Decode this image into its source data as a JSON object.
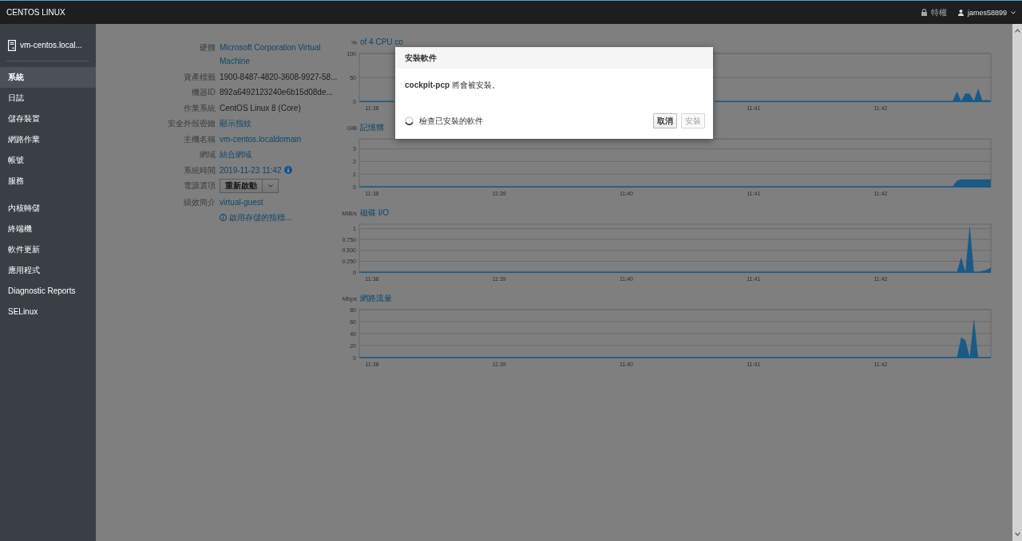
{
  "topbar": {
    "brand": "CENTOS LINUX",
    "privilege": "特權",
    "user": "james58899"
  },
  "sidebar": {
    "host": "vm-centos.local...",
    "groups": [
      {
        "items": [
          {
            "label": "系統",
            "selected": true
          },
          {
            "label": "日誌",
            "selected": false
          },
          {
            "label": "儲存裝置",
            "selected": false
          },
          {
            "label": "網路作業",
            "selected": false
          },
          {
            "label": "帳號",
            "selected": false
          },
          {
            "label": "服務",
            "selected": false
          }
        ]
      },
      {
        "items": [
          {
            "label": "內核轉儲",
            "selected": false
          },
          {
            "label": "終端機",
            "selected": false
          },
          {
            "label": "軟件更新",
            "selected": false
          },
          {
            "label": "應用程式",
            "selected": false
          },
          {
            "label": "Diagnostic Reports",
            "selected": false
          },
          {
            "label": "SELinux",
            "selected": false
          }
        ]
      }
    ]
  },
  "system_info": {
    "rows": [
      {
        "kind": "link",
        "label": "硬體",
        "value": "Microsoft Corporation Virtual Machine"
      },
      {
        "kind": "text",
        "label": "資產標籤",
        "value": "1900-8487-4820-3608-9927-58..."
      },
      {
        "kind": "text",
        "label": "機器ID",
        "value": "892a6492123240e6b15d08de..."
      },
      {
        "kind": "text",
        "label": "作業系統",
        "value": "CentOS Linux 8 (Core)"
      },
      {
        "kind": "link",
        "label": "安全外殼密鑰",
        "value": "顯示指紋"
      },
      {
        "kind": "link",
        "label": "主機名稱",
        "value": "vm-centos.localdomain"
      },
      {
        "kind": "link",
        "label": "網域",
        "value": "結合網域"
      },
      {
        "kind": "time",
        "label": "系統時間",
        "value": "2019-11-23 11:42"
      },
      {
        "kind": "split-button",
        "label": "電源選項",
        "value": "重新啟動"
      },
      {
        "kind": "link",
        "label": "績效簡介",
        "value": "virtual-guest"
      },
      {
        "kind": "info-link",
        "value": "啟用存儲的指標..."
      }
    ]
  },
  "charts": [
    {
      "chart_data": {
        "type": "area",
        "title": "of 4 CPU co",
        "ylabel": "%",
        "grid": true,
        "categories": [
          null,
          null,
          null,
          "11:38",
          null,
          null,
          null,
          null,
          null,
          null,
          null,
          null,
          null,
          null,
          null,
          null,
          null,
          null,
          null,
          null,
          null,
          null,
          null,
          null,
          null,
          null,
          null,
          null,
          null,
          null,
          null,
          null,
          null,
          null,
          null,
          null,
          null,
          null,
          null,
          null,
          null,
          null,
          null,
          null,
          null,
          null,
          null,
          null,
          null,
          null,
          null,
          null,
          null,
          null,
          null,
          null,
          null,
          null,
          null,
          null,
          null,
          null,
          null,
          null,
          null,
          null,
          null,
          null,
          null,
          null,
          null,
          null,
          null,
          null,
          null,
          null,
          null,
          null,
          null,
          null,
          null,
          null,
          null,
          null,
          null,
          null,
          null,
          null,
          null,
          null,
          null,
          null,
          null,
          "11:41",
          null,
          null,
          null,
          null,
          null,
          null,
          null,
          null,
          null,
          null,
          null,
          null,
          null,
          null,
          null,
          null,
          null,
          null,
          null,
          null,
          null,
          null,
          null,
          null,
          null,
          null,
          null,
          null,
          null,
          "11:42",
          null,
          null,
          null,
          null,
          null,
          null,
          null,
          null,
          null,
          null,
          null,
          null,
          null,
          null,
          null,
          null,
          null,
          null,
          null,
          null,
          null,
          null,
          null,
          null,
          null,
          null
        ],
        "series": [
          {
            "color": "#1a5b86",
            "values": [
              0,
              0,
              0,
              0,
              0,
              0,
              0,
              0,
              0,
              null,
              null,
              null,
              null,
              null,
              null,
              null,
              null,
              null,
              null,
              null,
              null,
              null,
              null,
              null,
              null,
              null,
              null,
              null,
              null,
              null,
              null,
              null,
              null,
              null,
              null,
              null,
              null,
              null,
              null,
              null,
              null,
              null,
              null,
              null,
              null,
              null,
              null,
              null,
              null,
              null,
              null,
              null,
              null,
              null,
              null,
              null,
              null,
              null,
              null,
              null,
              null,
              null,
              null,
              null,
              null,
              null,
              null,
              null,
              null,
              null,
              null,
              null,
              null,
              null,
              null,
              null,
              null,
              null,
              null,
              null,
              null,
              null,
              null,
              null,
              0,
              0,
              0,
              0,
              0,
              0,
              0,
              0,
              0,
              0,
              0,
              0,
              0,
              0,
              0,
              0,
              0,
              0,
              0,
              0,
              0,
              0,
              0,
              0,
              0,
              0,
              0,
              0,
              0,
              0,
              0,
              0,
              0,
              0,
              0,
              0,
              0,
              0,
              0,
              0,
              0,
              0,
              0,
              0,
              0,
              0,
              0,
              0,
              0,
              0,
              0,
              0,
              0,
              0,
              0,
              0,
              0,
              20,
              0,
              16,
              15,
              0,
              26,
              1,
              2,
              1
            ]
          }
        ],
        "ylim": [
          0,
          100
        ],
        "yticks": [
          0,
          50,
          100
        ]
      }
    },
    {
      "chart_data": {
        "type": "area",
        "title": "記憶體",
        "ylabel": "GiB",
        "grid": true,
        "categories": [
          null,
          null,
          null,
          "11:38",
          null,
          null,
          null,
          null,
          null,
          null,
          null,
          null,
          null,
          null,
          null,
          null,
          null,
          null,
          null,
          null,
          null,
          null,
          null,
          null,
          null,
          null,
          null,
          null,
          null,
          null,
          null,
          null,
          null,
          "11:39",
          null,
          null,
          null,
          null,
          null,
          null,
          null,
          null,
          null,
          null,
          null,
          null,
          null,
          null,
          null,
          null,
          null,
          null,
          null,
          null,
          null,
          null,
          null,
          null,
          null,
          null,
          null,
          null,
          null,
          "11:40",
          null,
          null,
          null,
          null,
          null,
          null,
          null,
          null,
          null,
          null,
          null,
          null,
          null,
          null,
          null,
          null,
          null,
          null,
          null,
          null,
          null,
          null,
          null,
          null,
          null,
          null,
          null,
          null,
          null,
          "11:41",
          null,
          null,
          null,
          null,
          null,
          null,
          null,
          null,
          null,
          null,
          null,
          null,
          null,
          null,
          null,
          null,
          null,
          null,
          null,
          null,
          null,
          null,
          null,
          null,
          null,
          null,
          null,
          null,
          null,
          "11:42",
          null,
          null,
          null,
          null,
          null,
          null,
          null,
          null,
          null,
          null,
          null,
          null,
          null,
          null,
          null,
          null,
          null,
          null,
          null,
          null,
          null,
          null,
          null,
          null,
          null,
          null
        ],
        "series": [
          {
            "color": "#1a5b86",
            "values": [
              0,
              0,
              0,
              0,
              0,
              0,
              0,
              0,
              0,
              0,
              0,
              0,
              0,
              0,
              0,
              0,
              0,
              0,
              0,
              0,
              0,
              0,
              0,
              0,
              0,
              0,
              0,
              0,
              0,
              0,
              0,
              0,
              0,
              0,
              0,
              0,
              0,
              0,
              0,
              0,
              0,
              0,
              0,
              0,
              0,
              0,
              0,
              0,
              0,
              0,
              0,
              0,
              0,
              0,
              0,
              0,
              0,
              0,
              0,
              0,
              0,
              0,
              0,
              0,
              0,
              0,
              0,
              0,
              0,
              0,
              0,
              0,
              0,
              0,
              0,
              0,
              0,
              0,
              0,
              0,
              0,
              0,
              0,
              0,
              0,
              0,
              0,
              0,
              0,
              0,
              0,
              0,
              0,
              0,
              0,
              0,
              0,
              0,
              0,
              0,
              0,
              0,
              0,
              0,
              0,
              0,
              0,
              0,
              0,
              0,
              0,
              0,
              0,
              0,
              0,
              0,
              0,
              0,
              0,
              0,
              0,
              0,
              0,
              0,
              0,
              0,
              0,
              0,
              0,
              0,
              0,
              0,
              0,
              0,
              0,
              0,
              0,
              0,
              0,
              0,
              0,
              0.45,
              0.55,
              0.55,
              0.55,
              0.55,
              0.55,
              0.55,
              0.55,
              0.55
            ]
          }
        ],
        "ylim": [
          0,
          3.8
        ],
        "yticks": [
          0,
          1,
          2,
          3
        ]
      }
    },
    {
      "chart_data": {
        "type": "area",
        "title": "磁碟 I/O",
        "ylabel": "MiB/s",
        "grid": true,
        "categories": [
          null,
          null,
          null,
          "11:38",
          null,
          null,
          null,
          null,
          null,
          null,
          null,
          null,
          null,
          null,
          null,
          null,
          null,
          null,
          null,
          null,
          null,
          null,
          null,
          null,
          null,
          null,
          null,
          null,
          null,
          null,
          null,
          null,
          null,
          "11:39",
          null,
          null,
          null,
          null,
          null,
          null,
          null,
          null,
          null,
          null,
          null,
          null,
          null,
          null,
          null,
          null,
          null,
          null,
          null,
          null,
          null,
          null,
          null,
          null,
          null,
          null,
          null,
          null,
          null,
          "11:40",
          null,
          null,
          null,
          null,
          null,
          null,
          null,
          null,
          null,
          null,
          null,
          null,
          null,
          null,
          null,
          null,
          null,
          null,
          null,
          null,
          null,
          null,
          null,
          null,
          null,
          null,
          null,
          null,
          null,
          "11:41",
          null,
          null,
          null,
          null,
          null,
          null,
          null,
          null,
          null,
          null,
          null,
          null,
          null,
          null,
          null,
          null,
          null,
          null,
          null,
          null,
          null,
          null,
          null,
          null,
          null,
          null,
          null,
          null,
          null,
          "11:42",
          null,
          null,
          null,
          null,
          null,
          null,
          null,
          null,
          null,
          null,
          null,
          null,
          null,
          null,
          null,
          null,
          null,
          null,
          null,
          null,
          null,
          null,
          null,
          null,
          null,
          null
        ],
        "series": [
          {
            "color": "#1a5b86",
            "values": [
              0,
              0,
              0,
              0,
              0,
              0,
              0,
              0,
              0,
              0,
              0,
              0,
              0,
              0,
              0,
              0,
              0,
              0,
              0,
              0,
              0,
              0,
              0,
              0,
              0,
              0,
              0,
              0,
              0,
              0,
              0,
              0,
              0,
              0,
              0,
              0,
              0,
              0,
              0,
              0,
              0,
              0,
              0,
              0,
              0,
              0,
              0,
              0,
              0,
              0,
              0,
              0,
              0,
              0,
              0,
              0,
              0,
              0,
              0,
              0,
              0,
              0,
              0,
              0,
              0,
              0,
              0,
              0,
              0,
              0,
              0,
              0,
              0,
              0,
              0,
              0,
              0,
              0,
              0,
              0,
              0,
              0,
              0,
              0,
              0,
              0,
              0,
              0,
              0,
              0,
              0,
              0,
              0,
              0,
              0,
              0,
              0,
              0,
              0,
              0,
              0,
              0,
              0,
              0,
              0,
              0,
              0,
              0,
              0,
              0,
              0,
              0,
              0,
              0,
              0,
              0,
              0,
              0,
              0,
              0,
              0,
              0,
              0,
              0,
              0,
              0,
              0,
              0,
              0,
              0,
              0,
              0,
              0,
              0,
              0,
              0,
              0,
              0,
              0,
              0,
              0,
              0,
              0.33,
              0,
              1.07,
              0,
              0,
              0.02,
              0.04,
              0.1
            ]
          }
        ],
        "ylim": [
          0,
          1.1
        ],
        "yticks": [
          0,
          {
            "value": 0.25,
            "label": "0.250"
          },
          {
            "value": 0.5,
            "label": "0.500"
          },
          {
            "value": 0.75,
            "label": "0.750"
          },
          1
        ]
      }
    },
    {
      "chart_data": {
        "type": "area",
        "title": "網路流量",
        "ylabel": "Mbps",
        "grid": true,
        "categories": [
          null,
          null,
          null,
          "11:38",
          null,
          null,
          null,
          null,
          null,
          null,
          null,
          null,
          null,
          null,
          null,
          null,
          null,
          null,
          null,
          null,
          null,
          null,
          null,
          null,
          null,
          null,
          null,
          null,
          null,
          null,
          null,
          null,
          null,
          "11:39",
          null,
          null,
          null,
          null,
          null,
          null,
          null,
          null,
          null,
          null,
          null,
          null,
          null,
          null,
          null,
          null,
          null,
          null,
          null,
          null,
          null,
          null,
          null,
          null,
          null,
          null,
          null,
          null,
          null,
          "11:40",
          null,
          null,
          null,
          null,
          null,
          null,
          null,
          null,
          null,
          null,
          null,
          null,
          null,
          null,
          null,
          null,
          null,
          null,
          null,
          null,
          null,
          null,
          null,
          null,
          null,
          null,
          null,
          null,
          null,
          "11:41",
          null,
          null,
          null,
          null,
          null,
          null,
          null,
          null,
          null,
          null,
          null,
          null,
          null,
          null,
          null,
          null,
          null,
          null,
          null,
          null,
          null,
          null,
          null,
          null,
          null,
          null,
          null,
          null,
          null,
          "11:42",
          null,
          null,
          null,
          null,
          null,
          null,
          null,
          null,
          null,
          null,
          null,
          null,
          null,
          null,
          null,
          null,
          null,
          null,
          null,
          null,
          null,
          null,
          null,
          null,
          null,
          null
        ],
        "series": [
          {
            "color": "#1a5b86",
            "values": [
              0,
              0,
              0,
              0,
              0,
              0,
              0,
              0,
              0,
              0,
              0,
              0,
              0,
              0,
              0,
              0,
              0,
              0,
              0,
              0,
              0,
              0,
              0,
              0,
              0,
              0,
              0,
              0,
              0,
              0,
              0,
              0,
              0,
              0,
              0,
              0,
              0,
              0,
              0,
              0,
              0,
              0,
              0,
              0,
              0,
              0,
              0,
              0,
              0,
              0,
              0,
              0,
              0,
              0,
              0,
              0,
              0,
              0,
              0,
              0,
              0,
              0,
              0,
              0,
              0,
              0,
              0,
              0,
              0,
              0,
              0,
              0,
              0,
              0,
              0,
              0,
              0,
              0,
              0,
              0,
              0,
              0,
              0,
              0,
              0,
              0,
              0,
              0,
              0,
              0,
              0,
              0,
              0,
              0,
              0,
              0,
              0,
              0,
              0,
              0,
              0,
              0,
              0,
              0,
              0,
              0,
              0,
              0,
              0,
              0,
              0,
              0,
              0,
              0,
              0,
              0,
              0,
              0,
              0,
              0,
              0,
              0,
              0,
              0,
              0,
              0,
              0,
              0,
              0,
              0,
              0,
              0,
              0,
              0,
              0,
              0,
              0,
              0,
              0,
              0,
              0,
              0,
              33,
              28,
              0,
              65,
              0,
              0,
              0,
              0
            ]
          }
        ],
        "ylim": [
          0,
          80
        ],
        "yticks": [
          0,
          20,
          40,
          60,
          80
        ]
      }
    }
  ],
  "dialog": {
    "title": "安裝軟件",
    "message": "**cockpit-pcp** 將會被安裝。",
    "status": "檢查已安裝的軟件",
    "buttons": [
      {
        "label": "取消",
        "disabled": false
      },
      {
        "label": "安裝",
        "disabled": true
      }
    ]
  }
}
